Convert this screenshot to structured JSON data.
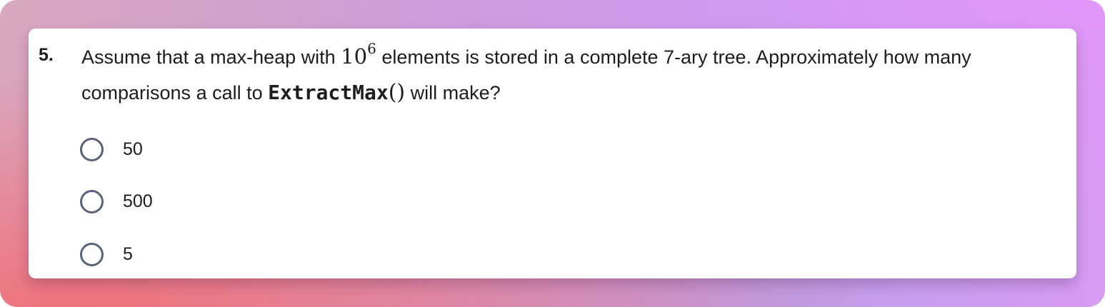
{
  "question": {
    "number": "5.",
    "text_part1": "Assume that a max-heap with ",
    "math_base": "10",
    "math_exponent": "6",
    "text_part2": " elements is stored in a complete 7-ary tree. Approximately how many comparisons a call to ",
    "function_name": "ExtractMax",
    "function_parens": "()",
    "text_part3": " will make?"
  },
  "options": [
    {
      "label": "50",
      "selected": false
    },
    {
      "label": "500",
      "selected": false
    },
    {
      "label": "5",
      "selected": false
    }
  ],
  "colors": {
    "card_background": "#ffffff",
    "radio_border": "#5a6478",
    "text": "#1d1d1f"
  }
}
